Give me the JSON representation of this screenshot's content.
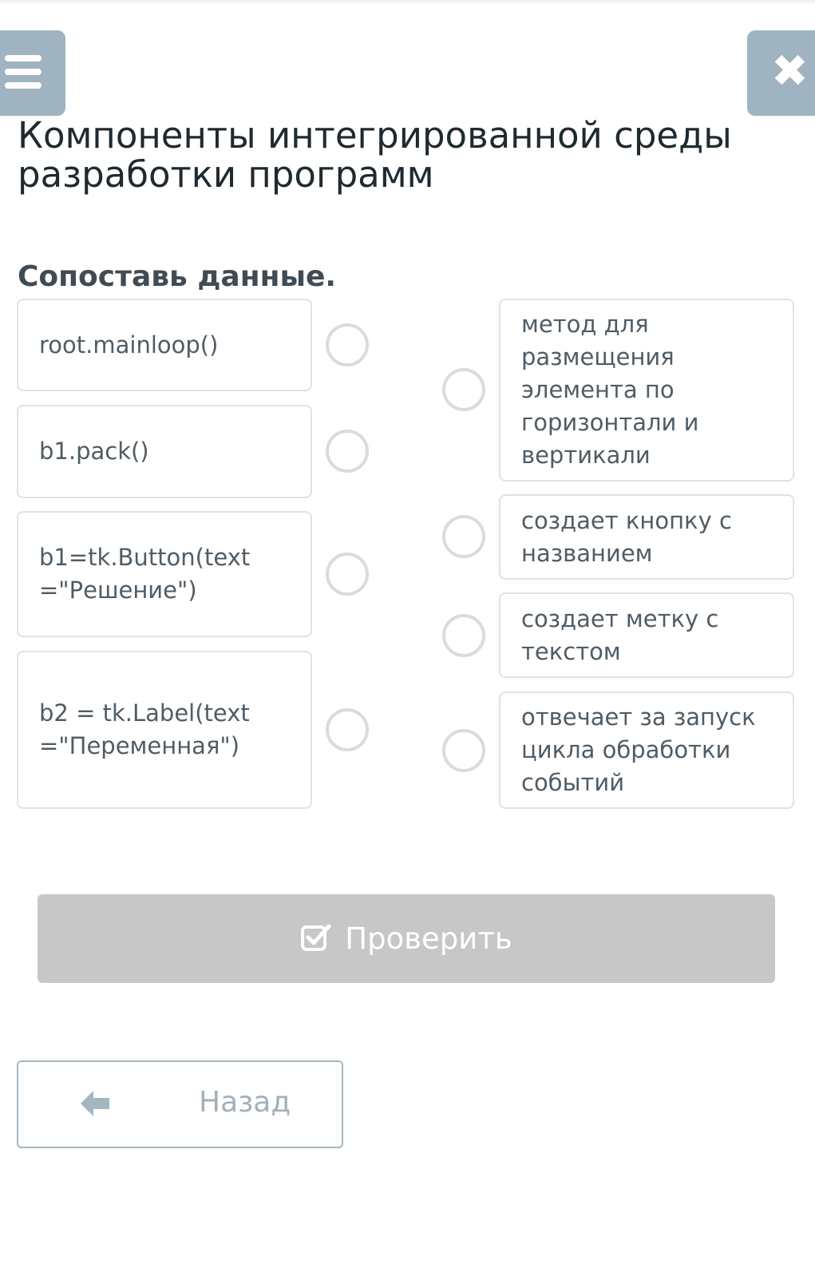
{
  "header": {
    "menu_icon": "hamburger-menu-icon",
    "close_icon": "close-x-icon"
  },
  "page": {
    "title": "Компоненты интегрированной среды разработки программ",
    "instruction": "Сопоставь данные."
  },
  "match": {
    "left_items": [
      {
        "label": "root.mainloop()"
      },
      {
        "label": "b1.pack()"
      },
      {
        "label": "b1=tk.Button(text=\"Решение\")"
      },
      {
        "label": "b2 = tk.Label(text=\"Переменная\")"
      }
    ],
    "right_items": [
      {
        "label": "метод для размещения элемента по горизонтали и вертикали"
      },
      {
        "label": "создает кнопку с названием"
      },
      {
        "label": "создает метку с текстом"
      },
      {
        "label": "отвечает за запуск цикла обработки событий"
      }
    ]
  },
  "actions": {
    "check_label": "Проверить",
    "check_icon": "checkbox-check-icon",
    "back_label": "Назад",
    "back_icon": "arrow-left-icon"
  },
  "colors": {
    "header_button": "#9fb3c0",
    "check_button_disabled": "#c7c7c7",
    "card_border": "#dde3e7",
    "radio_border": "#d6dcdf"
  }
}
